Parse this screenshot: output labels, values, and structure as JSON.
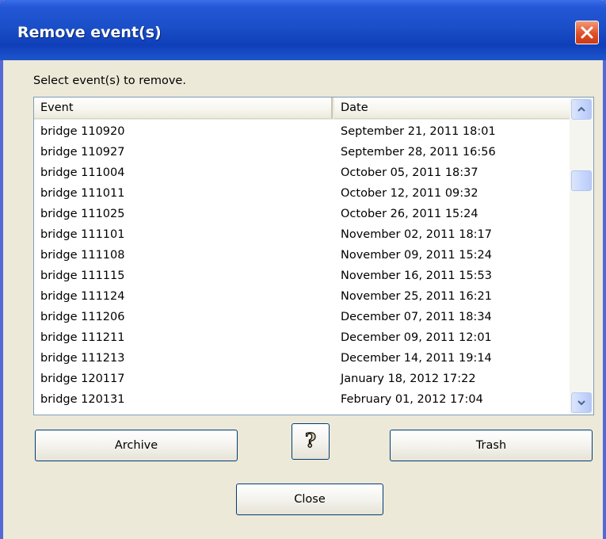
{
  "window": {
    "title": "Remove event(s)"
  },
  "prompt": "Select event(s) to remove.",
  "list": {
    "columns": [
      "Event",
      "Date"
    ],
    "rows": [
      {
        "event": "bridge 110920",
        "date": "September 21, 2011 18:01"
      },
      {
        "event": "bridge 110927",
        "date": "September 28, 2011 16:56"
      },
      {
        "event": "bridge 111004",
        "date": "October 05, 2011 18:37"
      },
      {
        "event": "bridge 111011",
        "date": "October 12, 2011 09:32"
      },
      {
        "event": "bridge 111025",
        "date": "October 26, 2011 15:24"
      },
      {
        "event": "bridge 111101",
        "date": "November 02, 2011 18:17"
      },
      {
        "event": "bridge 111108",
        "date": "November 09, 2011 15:24"
      },
      {
        "event": "bridge 111115",
        "date": "November 16, 2011 15:53"
      },
      {
        "event": "bridge 111124",
        "date": "November 25, 2011 16:21"
      },
      {
        "event": "bridge 111206",
        "date": "December 07, 2011 18:34"
      },
      {
        "event": "bridge 111211",
        "date": "December 09, 2011 12:01"
      },
      {
        "event": "bridge 111213",
        "date": "December 14, 2011 19:14"
      },
      {
        "event": "bridge 120117",
        "date": "January 18, 2012 17:22"
      },
      {
        "event": "bridge 120131",
        "date": "February 01, 2012 17:04"
      }
    ]
  },
  "buttons": {
    "archive": "Archive",
    "help_symbol": "?",
    "trash": "Trash",
    "close": "Close"
  },
  "icons": {
    "close": "close-icon",
    "help": "help-icon",
    "scroll_up": "chevron-up-icon",
    "scroll_down": "chevron-down-icon"
  },
  "colors": {
    "titlebar": "#0f3fb8",
    "dialog_bg": "#ece9d8",
    "close_button": "#e0512a",
    "list_border": "#7f9db9"
  }
}
